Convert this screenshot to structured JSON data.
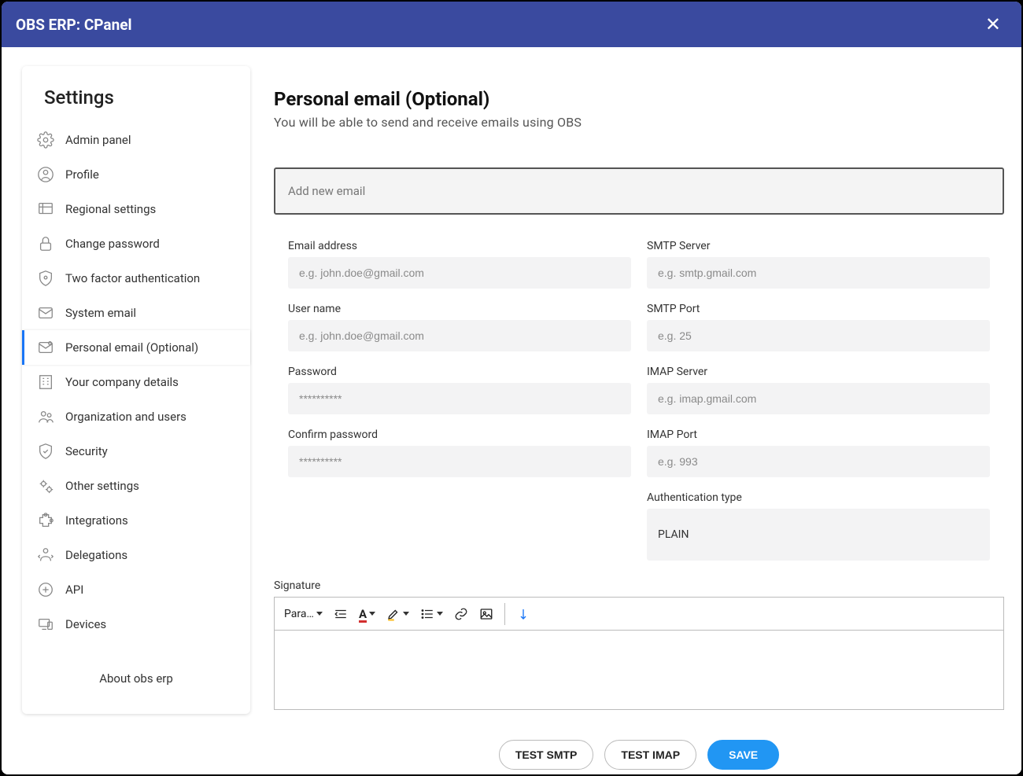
{
  "window": {
    "title": "OBS ERP: CPanel"
  },
  "sidebar": {
    "title": "Settings",
    "items": [
      {
        "label": "Admin panel"
      },
      {
        "label": "Profile"
      },
      {
        "label": "Regional settings"
      },
      {
        "label": "Change password"
      },
      {
        "label": "Two factor authentication"
      },
      {
        "label": "System email"
      },
      {
        "label": "Personal email (Optional)"
      },
      {
        "label": "Your company details"
      },
      {
        "label": "Organization and users"
      },
      {
        "label": "Security"
      },
      {
        "label": "Other settings"
      },
      {
        "label": "Integrations"
      },
      {
        "label": "Delegations"
      },
      {
        "label": "API"
      },
      {
        "label": "Devices"
      }
    ],
    "footer": "About obs erp"
  },
  "page": {
    "title": "Personal email (Optional)",
    "subtitle": "You will be able to send and receive emails using OBS",
    "add_label": "Add new email"
  },
  "fields": {
    "email_label": "Email address",
    "email_ph": "e.g. john.doe@gmail.com",
    "user_label": "User name",
    "user_ph": "e.g. john.doe@gmail.com",
    "pass_label": "Password",
    "pass_ph": "**********",
    "confirm_label": "Confirm password",
    "confirm_ph": "**********",
    "smtp_server_label": "SMTP Server",
    "smtp_server_ph": "e.g. smtp.gmail.com",
    "smtp_port_label": "SMTP Port",
    "smtp_port_ph": "e.g. 25",
    "imap_server_label": "IMAP Server",
    "imap_server_ph": "e.g. imap.gmail.com",
    "imap_port_label": "IMAP Port",
    "imap_port_ph": "e.g. 993",
    "auth_label": "Authentication type",
    "auth_value": "PLAIN",
    "signature_label": "Signature"
  },
  "editor": {
    "paragraph_label": "Paragraph"
  },
  "actions": {
    "test_smtp": "TEST SMTP",
    "test_imap": "TEST IMAP",
    "save": "SAVE"
  }
}
